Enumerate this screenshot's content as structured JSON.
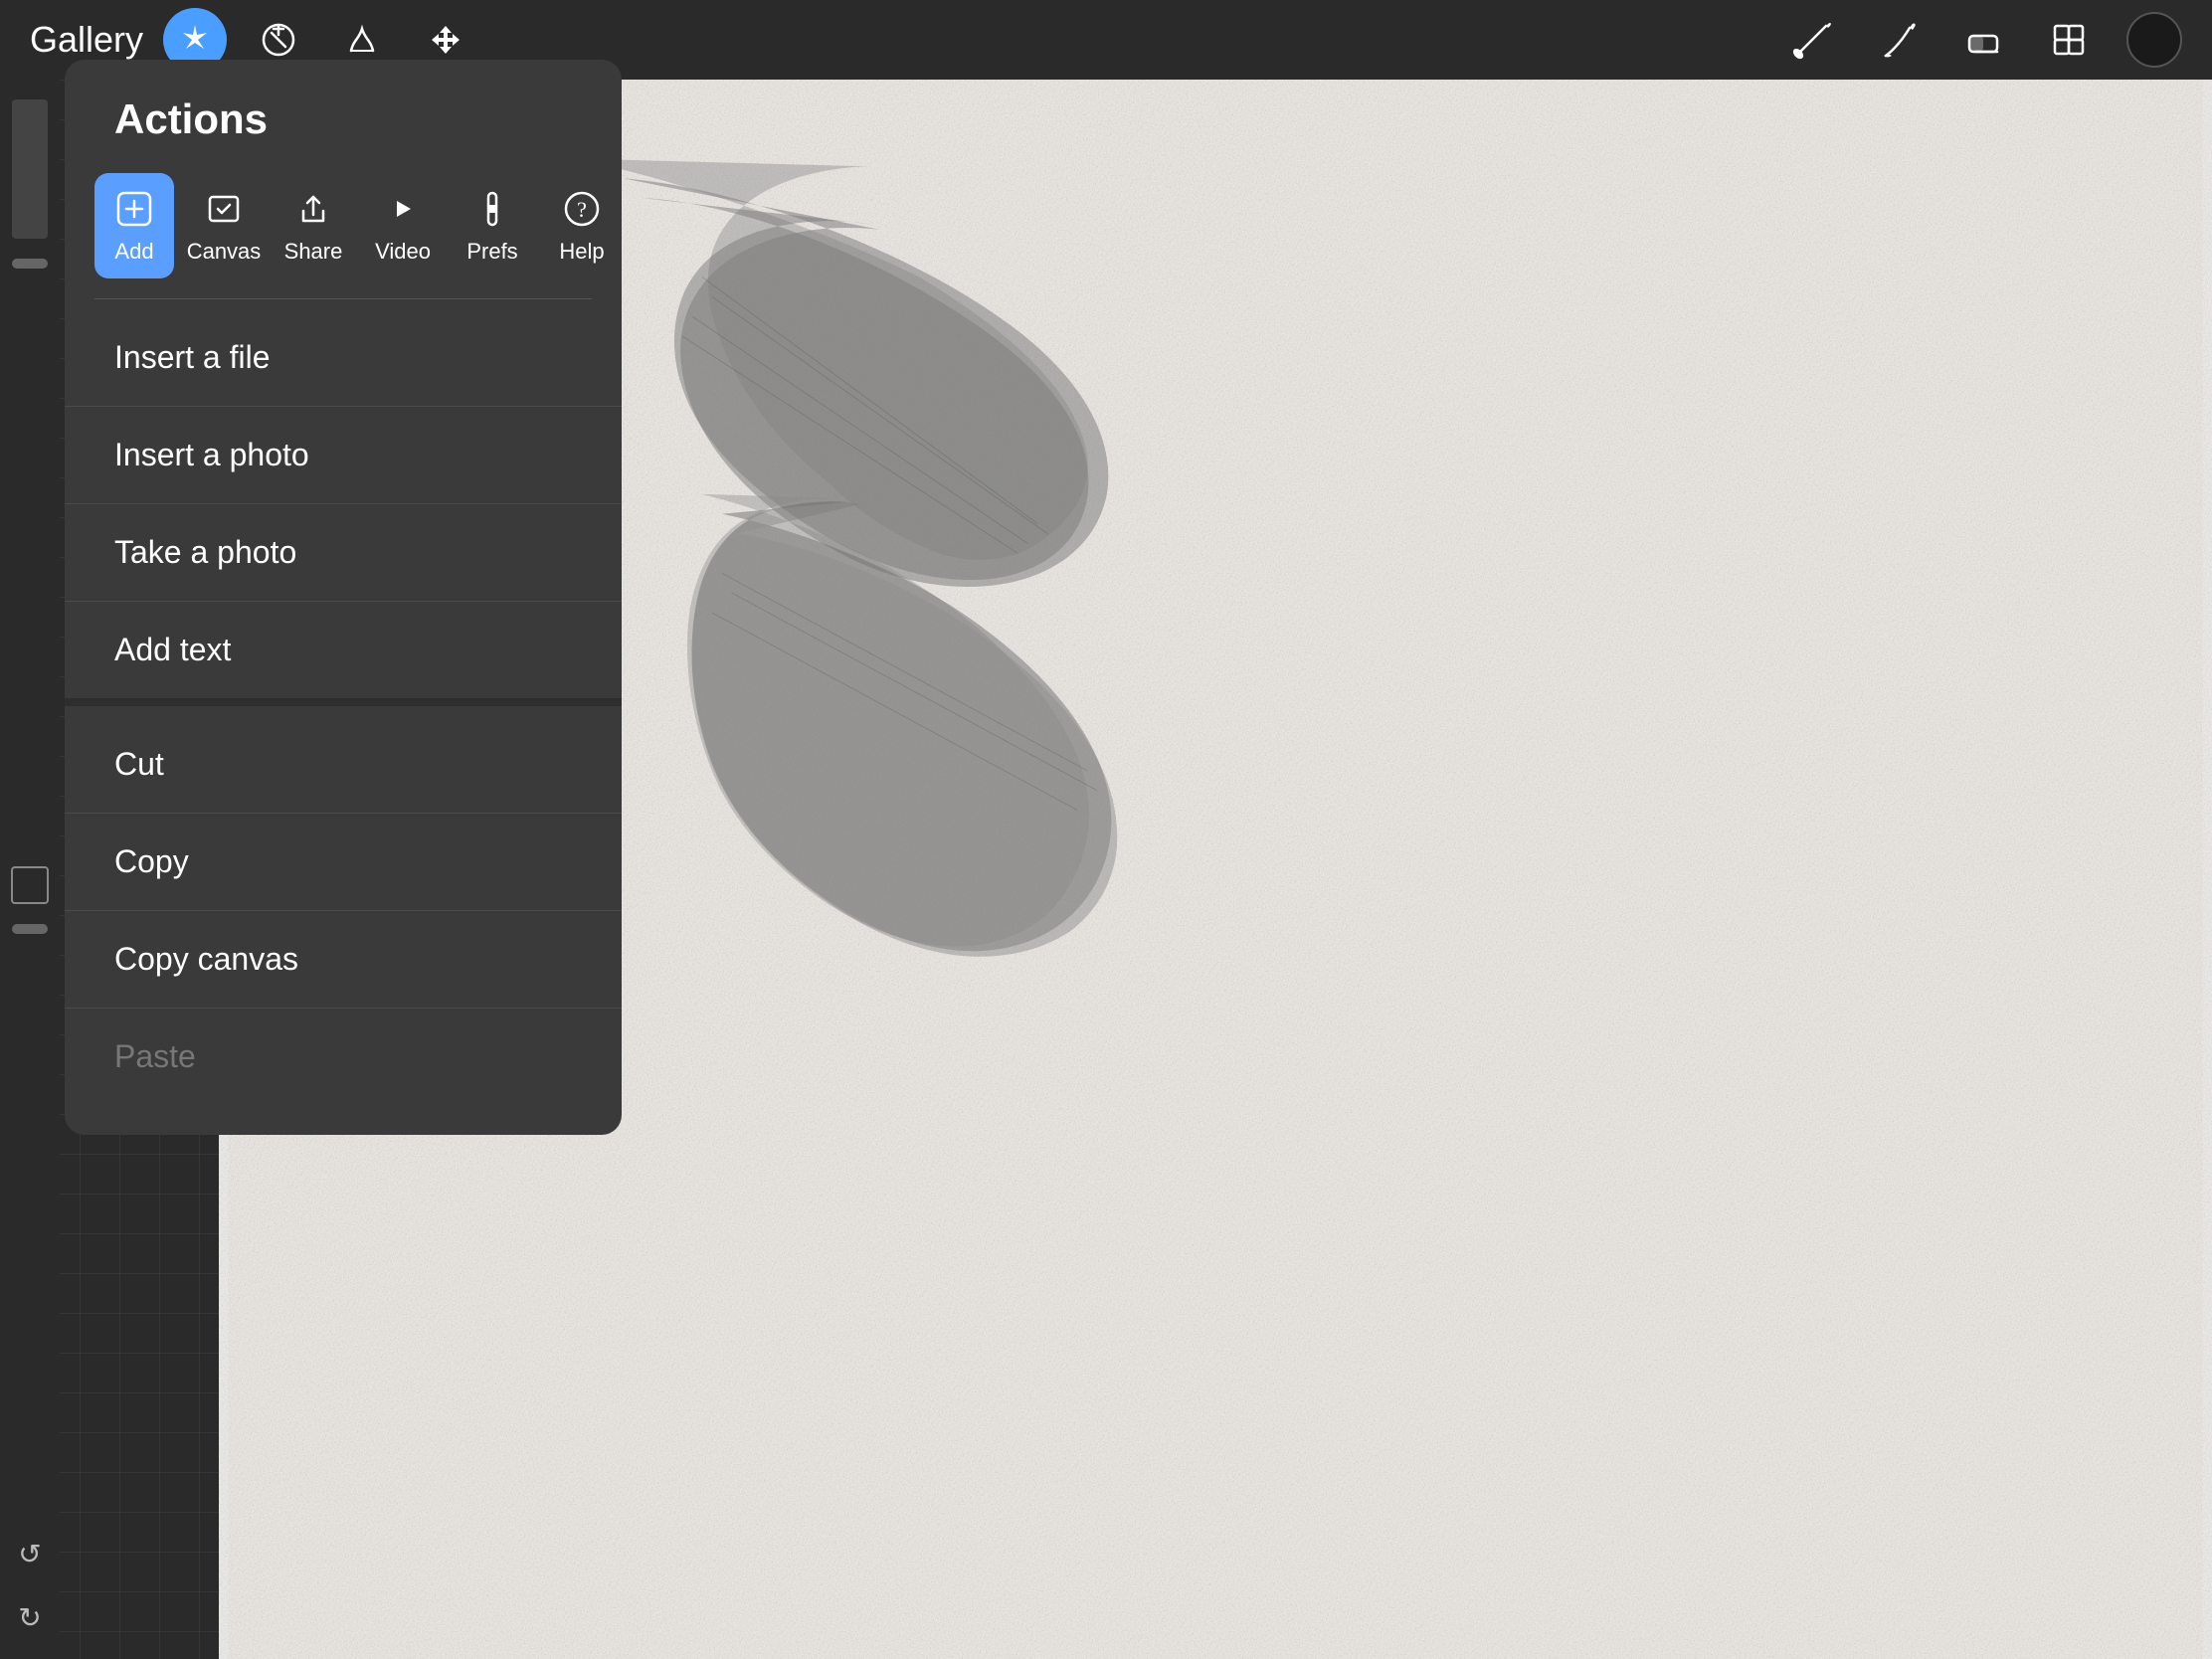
{
  "toolbar": {
    "gallery_label": "Gallery",
    "tools": [
      {
        "name": "magic-wand",
        "icon": "✦",
        "active": true
      },
      {
        "name": "adjust",
        "icon": "↗",
        "active": false
      },
      {
        "name": "sketch",
        "icon": "S",
        "active": false
      },
      {
        "name": "move",
        "icon": "➤",
        "active": false
      }
    ],
    "right_tools": [
      {
        "name": "brush-tool",
        "label": "brush"
      },
      {
        "name": "smudge-tool",
        "label": "smudge"
      },
      {
        "name": "eraser-tool",
        "label": "eraser"
      },
      {
        "name": "layers-tool",
        "label": "layers"
      }
    ]
  },
  "actions_panel": {
    "title": "Actions",
    "tabs": [
      {
        "id": "add",
        "label": "Add",
        "active": true
      },
      {
        "id": "canvas",
        "label": "Canvas",
        "active": false
      },
      {
        "id": "share",
        "label": "Share",
        "active": false
      },
      {
        "id": "video",
        "label": "Video",
        "active": false
      },
      {
        "id": "prefs",
        "label": "Prefs",
        "active": false
      },
      {
        "id": "help",
        "label": "Help",
        "active": false
      }
    ],
    "menu_items_1": [
      {
        "id": "insert-file",
        "label": "Insert a file",
        "disabled": false
      },
      {
        "id": "insert-photo",
        "label": "Insert a photo",
        "disabled": false
      },
      {
        "id": "take-photo",
        "label": "Take a photo",
        "disabled": false
      },
      {
        "id": "add-text",
        "label": "Add text",
        "disabled": false
      }
    ],
    "menu_items_2": [
      {
        "id": "cut",
        "label": "Cut",
        "disabled": false
      },
      {
        "id": "copy",
        "label": "Copy",
        "disabled": false
      },
      {
        "id": "copy-canvas",
        "label": "Copy canvas",
        "disabled": false
      },
      {
        "id": "paste",
        "label": "Paste",
        "disabled": true
      }
    ]
  }
}
